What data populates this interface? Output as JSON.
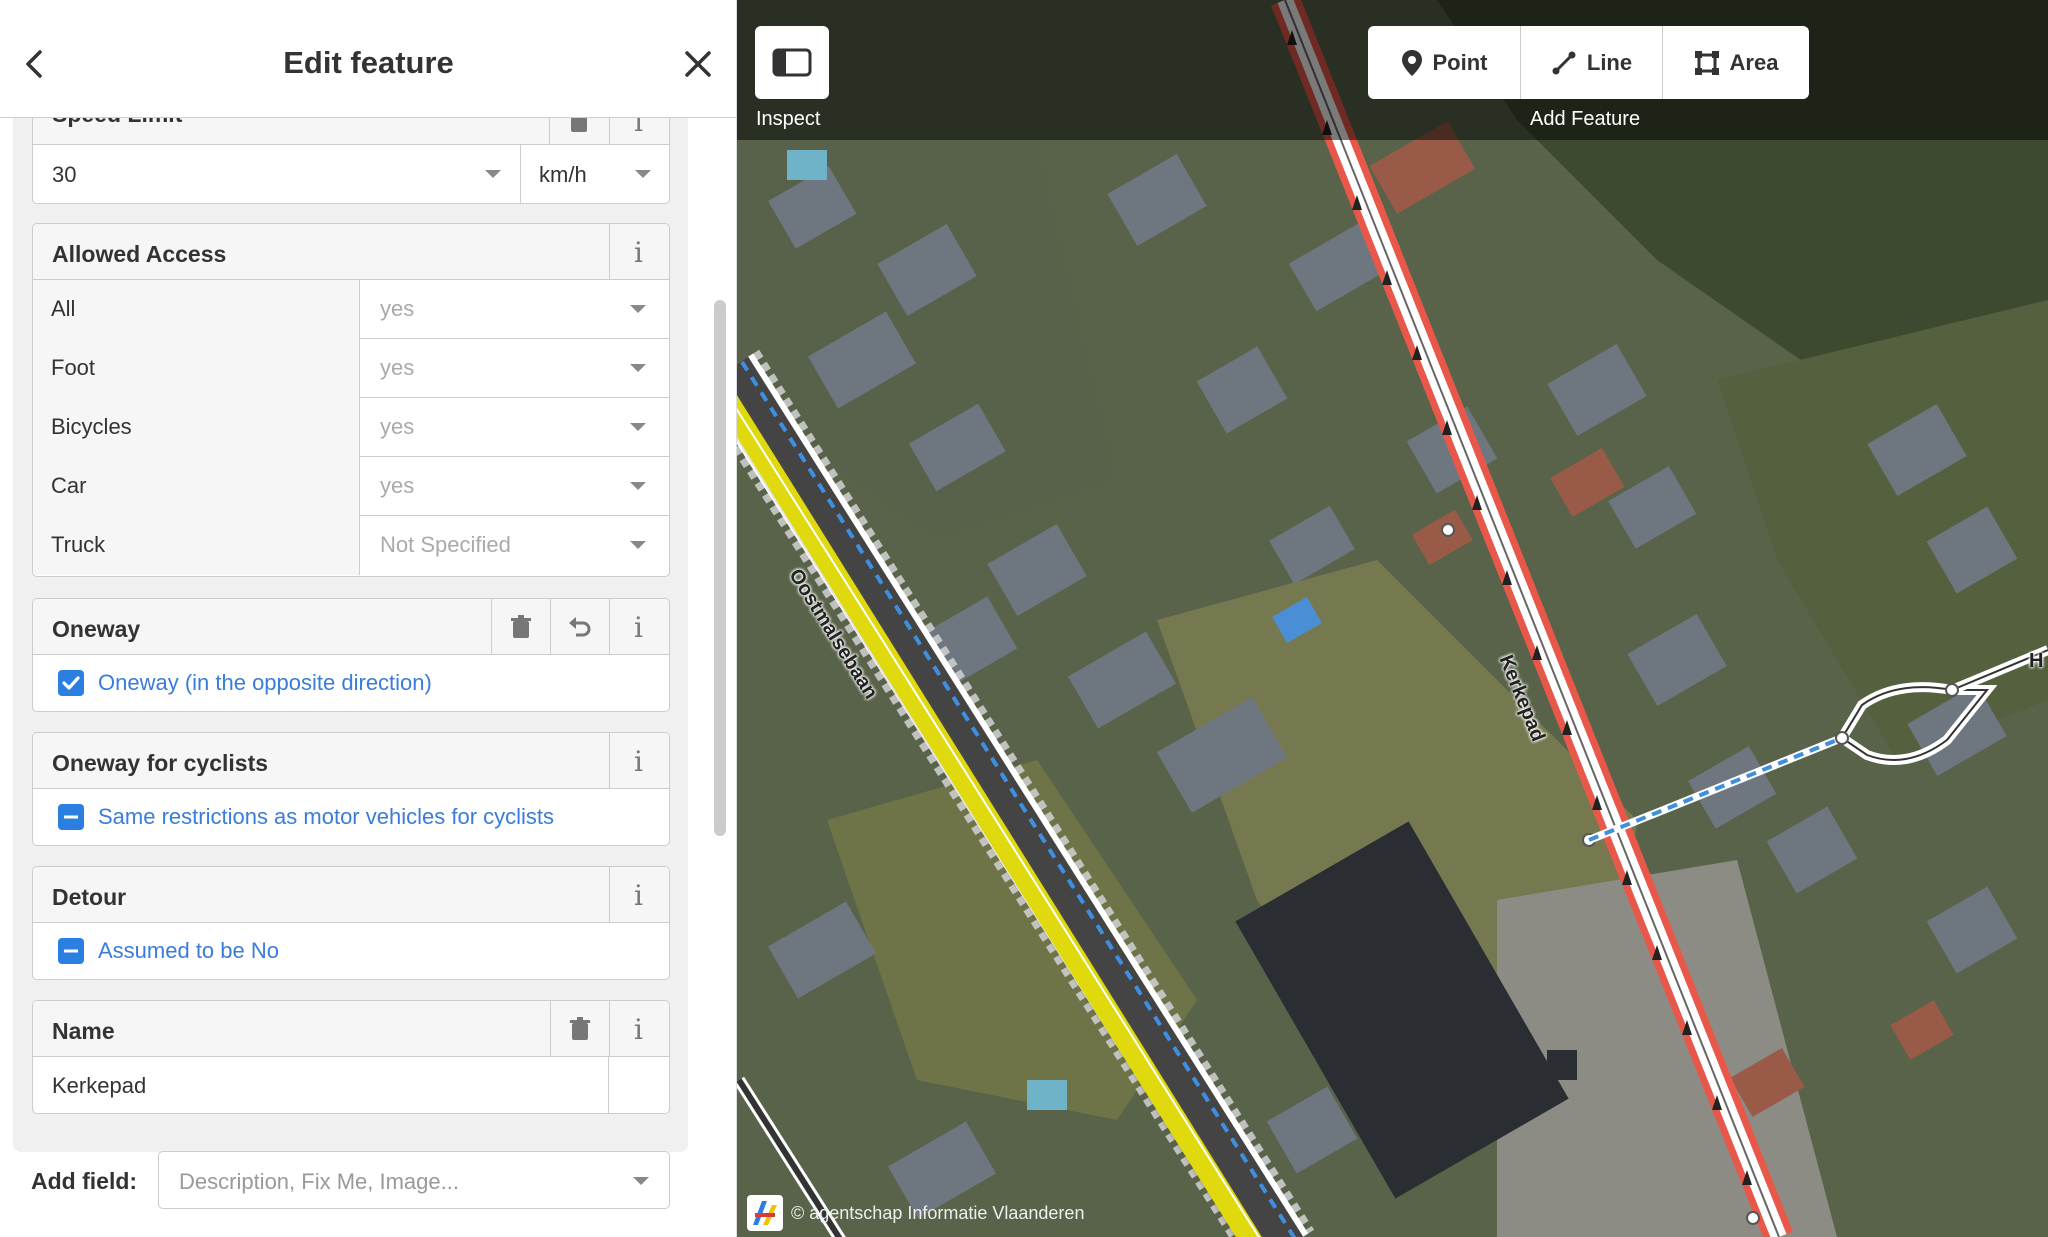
{
  "sidebar": {
    "title": "Edit feature",
    "speed_limit": {
      "label": "Speed Limit",
      "value": "30",
      "unit": "km/h"
    },
    "allowed_access": {
      "label": "Allowed Access",
      "rows": [
        {
          "key": "All",
          "value": "yes"
        },
        {
          "key": "Foot",
          "value": "yes"
        },
        {
          "key": "Bicycles",
          "value": "yes"
        },
        {
          "key": "Car",
          "value": "yes"
        },
        {
          "key": "Truck",
          "value": "Not Specified"
        }
      ]
    },
    "oneway": {
      "label": "Oneway",
      "option": "Oneway (in the opposite direction)",
      "checked": true
    },
    "oneway_cyclists": {
      "label": "Oneway for cyclists",
      "option": "Same restrictions as motor vehicles for cyclists"
    },
    "detour": {
      "label": "Detour",
      "option": "Assumed to be No"
    },
    "name": {
      "label": "Name",
      "value": "Kerkepad"
    },
    "add_field": {
      "label": "Add field:",
      "placeholder": "Description, Fix Me, Image..."
    }
  },
  "map": {
    "toolbar": {
      "inspect_label": "Inspect",
      "modes": [
        "Point",
        "Line",
        "Area"
      ],
      "add_feature_label": "Add Feature"
    },
    "roads": {
      "oostmalsebaan": "Oostmalsebaan",
      "kerkepad": "Kerkepad",
      "edge_label": "H"
    },
    "attribution": "© agentschap Informatie Vlaanderen",
    "colors": {
      "kerkepad_highlight": "#e8584a",
      "primary_road": "#f7f000",
      "cycleway": "#3f8fe0"
    }
  }
}
